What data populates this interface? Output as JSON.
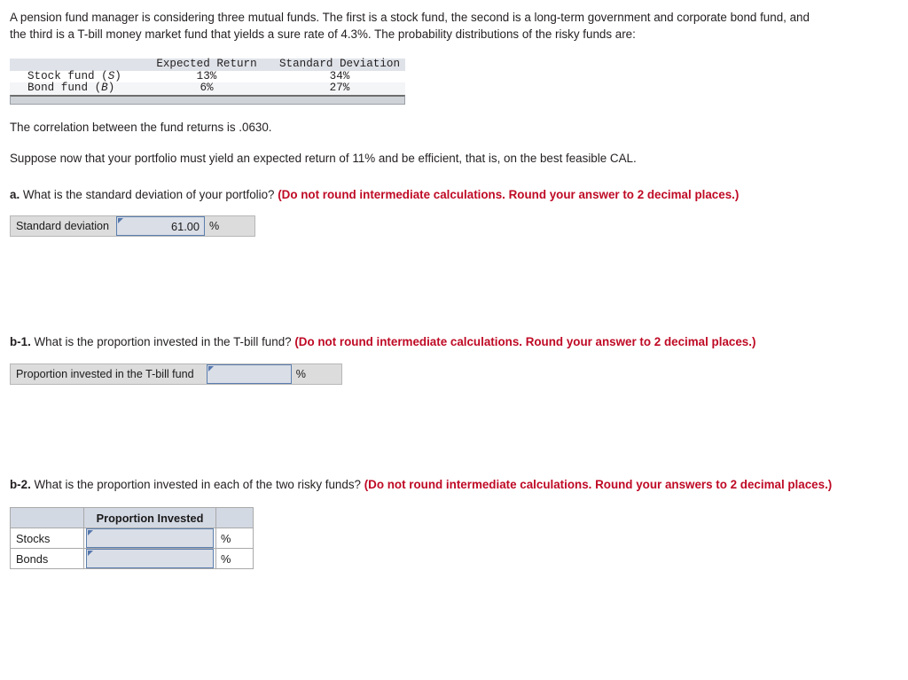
{
  "problem": {
    "intro": "A pension fund manager is considering three mutual funds. The first is a stock fund, the second is a long-term government and corporate bond fund, and the third is a T-bill money market fund that yields a sure rate of 4.3%. The probability distributions of the risky funds are:",
    "correlation_line": "The correlation between the fund returns is .0630.",
    "condition_line": "Suppose now that your portfolio must yield an expected return of 11% and be efficient, that is, on the best feasible CAL."
  },
  "fund_table": {
    "columns": [
      "",
      "Expected Return",
      "Standard Deviation"
    ],
    "rows": [
      {
        "name_prefix": "Stock fund (",
        "symbol": "S",
        "name_suffix": ")",
        "expected_return": "13%",
        "standard_deviation": "34%"
      },
      {
        "name_prefix": "Bond fund (",
        "symbol": "B",
        "name_suffix": ")",
        "expected_return": "6%",
        "standard_deviation": "27%"
      }
    ]
  },
  "questions": [
    {
      "label": "a.",
      "text": " What is the standard deviation of your portfolio? ",
      "hint": "(Do not round intermediate calculations. Round your answer to 2 decimal places.)",
      "answer": {
        "row_label": "Standard deviation",
        "value": "61.00",
        "unit": "%",
        "placeholder": ""
      }
    },
    {
      "label": "b-1.",
      "text": " What is the proportion invested in the T-bill fund? ",
      "hint": "(Do not round intermediate calculations. Round your answer to 2 decimal places.)",
      "answer": {
        "row_label": "Proportion invested in the T-bill fund",
        "value": "",
        "unit": "%",
        "placeholder": ""
      }
    },
    {
      "label": "b-2.",
      "text": " What is the proportion invested in each of the two risky funds? ",
      "hint": "(Do not round intermediate calculations. Round your answers to 2 decimal places.)",
      "answer_table": {
        "header": {
          "blank": "",
          "main": "Proportion Invested",
          "unit": ""
        },
        "rows": [
          {
            "name": "Stocks",
            "value": "",
            "unit": "%"
          },
          {
            "name": "Bonds",
            "value": "",
            "unit": "%"
          }
        ]
      }
    }
  ],
  "colors": {
    "hint_red": "#bf0a25",
    "input_border": "#5b7faf",
    "input_fill": "#dadee6",
    "strip_fill": "#dcdcdc",
    "table_header_fill": "#d3d9e3",
    "fin_header_fill": "#dfe3e9"
  }
}
